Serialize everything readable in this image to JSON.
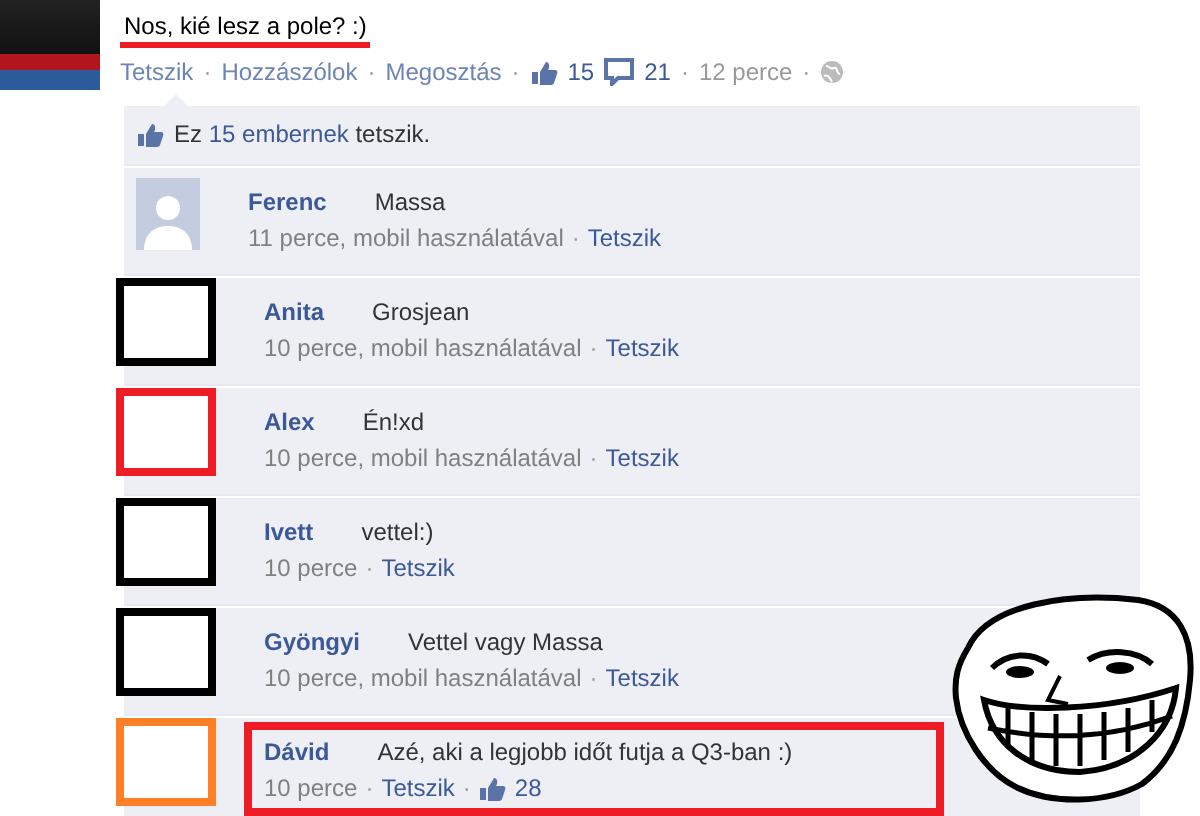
{
  "post": {
    "text": "Nos, kié lesz a pole? :)",
    "underlined": true,
    "footer": [
      {
        "kind": "link",
        "text": "Tetszik"
      },
      {
        "kind": "separator",
        "text": "·"
      },
      {
        "kind": "link",
        "text": "Hozzászólok"
      },
      {
        "kind": "separator",
        "text": "·"
      },
      {
        "kind": "link",
        "text": "Megosztás"
      },
      {
        "kind": "separator",
        "text": "·"
      },
      {
        "kind": "likes",
        "text": "15"
      },
      {
        "kind": "comments",
        "text": "21"
      },
      {
        "kind": "separator",
        "text": "·"
      },
      {
        "kind": "time",
        "text": "12 perce"
      },
      {
        "kind": "separator",
        "text": "·"
      },
      {
        "kind": "globe"
      }
    ]
  },
  "likes_summary": {
    "prefix": "Ez",
    "link": "15 embernek",
    "suffix": "tetszik."
  },
  "comments": [
    {
      "kind": "silhouette",
      "author": "Ferenc",
      "text": "Massa",
      "framed": false,
      "footer": [
        {
          "kind": "time",
          "text": "11 perce, mobil használatával"
        },
        {
          "kind": "separator",
          "text": "·"
        },
        {
          "kind": "link",
          "text": "Tetszik"
        }
      ]
    },
    {
      "kind": "blank",
      "color": "#000000",
      "author": "Anita",
      "text": "Grosjean",
      "framed": false,
      "footer": [
        {
          "kind": "time",
          "text": "10 perce, mobil használatával"
        },
        {
          "kind": "separator",
          "text": "·"
        },
        {
          "kind": "link",
          "text": "Tetszik"
        }
      ]
    },
    {
      "kind": "blank",
      "color": "#ee1c24",
      "author": "Alex",
      "text": "Én!xd",
      "framed": false,
      "footer": [
        {
          "kind": "time",
          "text": "10 perce, mobil használatával"
        },
        {
          "kind": "separator",
          "text": "·"
        },
        {
          "kind": "link",
          "text": "Tetszik"
        }
      ]
    },
    {
      "kind": "blank",
      "color": "#000000",
      "author": "Ivett",
      "text": "vettel:)",
      "framed": false,
      "footer": [
        {
          "kind": "time",
          "text": "10 perce"
        },
        {
          "kind": "separator",
          "text": "·"
        },
        {
          "kind": "link",
          "text": "Tetszik"
        }
      ]
    },
    {
      "kind": "blank",
      "color": "#000000",
      "author": "Gyöngyi",
      "text": "Vettel vagy Massa",
      "framed": false,
      "footer": [
        {
          "kind": "time",
          "text": "10 perce, mobil használatával"
        },
        {
          "kind": "separator",
          "text": "·"
        },
        {
          "kind": "link",
          "text": "Tetszik"
        }
      ]
    },
    {
      "kind": "blank",
      "color": "#ff7f27",
      "author": "Dávid",
      "text": "Azé, aki a legjobb időt futja a Q3-ban :)",
      "framed": true,
      "footer": [
        {
          "kind": "time",
          "text": "10 perce"
        },
        {
          "kind": "separator",
          "text": "·"
        },
        {
          "kind": "link",
          "text": "Tetszik"
        },
        {
          "kind": "separator",
          "text": "·"
        },
        {
          "kind": "likes",
          "text": "28"
        }
      ]
    }
  ]
}
